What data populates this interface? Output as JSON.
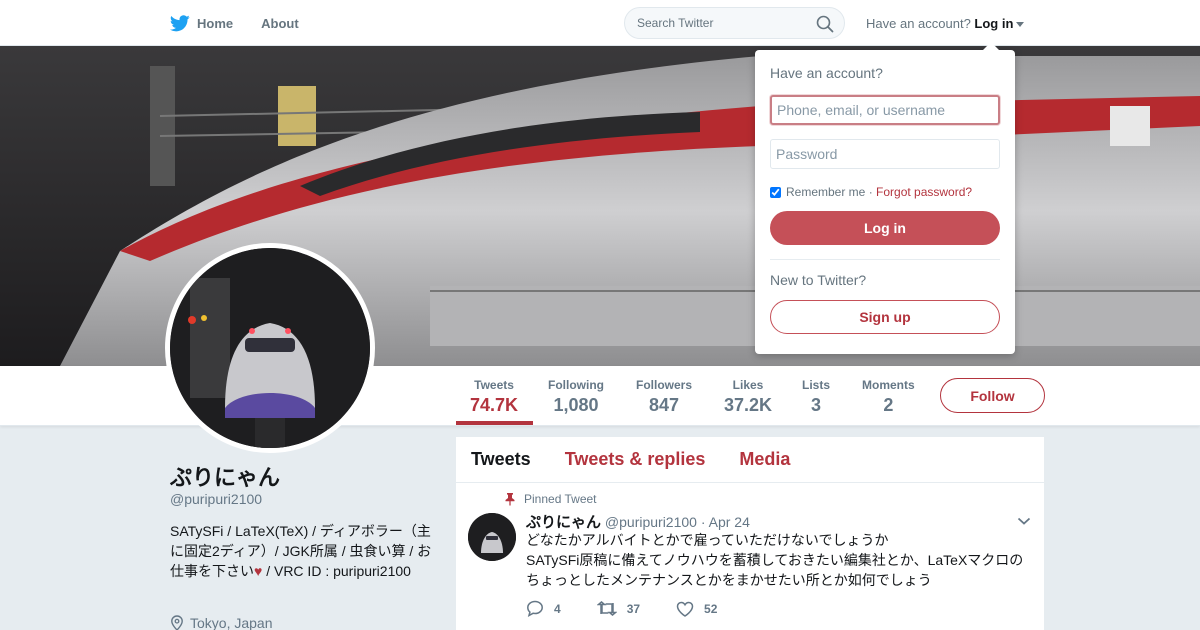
{
  "nav": {
    "home_label": "Home",
    "about_label": "About",
    "search_placeholder": "Search Twitter",
    "have_account": "Have an account?",
    "login_label": "Log in"
  },
  "profile": {
    "name": "ぷりにゃん",
    "handle": "@puripuri2100",
    "bio_before_heart": "SATySFi / LaTeX(TeX) / ディアボラー（主に固定2ディア）/ JGK所属 / 虫食い算 / お仕事を下さい",
    "bio_heart": "♥",
    "bio_after_heart": " / VRC ID : puripuri2100",
    "location": "Tokyo, Japan",
    "follow_label": "Follow"
  },
  "stats": [
    {
      "label": "Tweets",
      "value": "74.7K"
    },
    {
      "label": "Following",
      "value": "1,080"
    },
    {
      "label": "Followers",
      "value": "847"
    },
    {
      "label": "Likes",
      "value": "37.2K"
    },
    {
      "label": "Lists",
      "value": "3"
    },
    {
      "label": "Moments",
      "value": "2"
    }
  ],
  "tabs": [
    "Tweets",
    "Tweets & replies",
    "Media"
  ],
  "tweet": {
    "pinned_label": "Pinned Tweet",
    "author": "ぷりにゃん",
    "handle": "@puripuri2100",
    "date": "· Apr 24",
    "lines": [
      "どなたかアルバイトとかで雇っていただけないでしょうか",
      "SATySFi原稿に備えてノウハウを蓄積しておきたい編集社とか、LaTeXマクロのちょっとしたメンテナンスとかをまかせたい所とか如何でしょう"
    ],
    "replies": "4",
    "retweets": "37",
    "likes": "52"
  },
  "login": {
    "title": "Have an account?",
    "user_placeholder": "Phone, email, or username",
    "password_placeholder": "Password",
    "remember": "Remember me",
    "separator": " · ",
    "forgot": "Forgot password?",
    "login_button": "Log in",
    "new_to": "New to Twitter?",
    "signup_button": "Sign up"
  },
  "colors": {
    "accent": "#b3343e",
    "button": "#c55058",
    "text": "#14171a",
    "muted": "#657786"
  }
}
